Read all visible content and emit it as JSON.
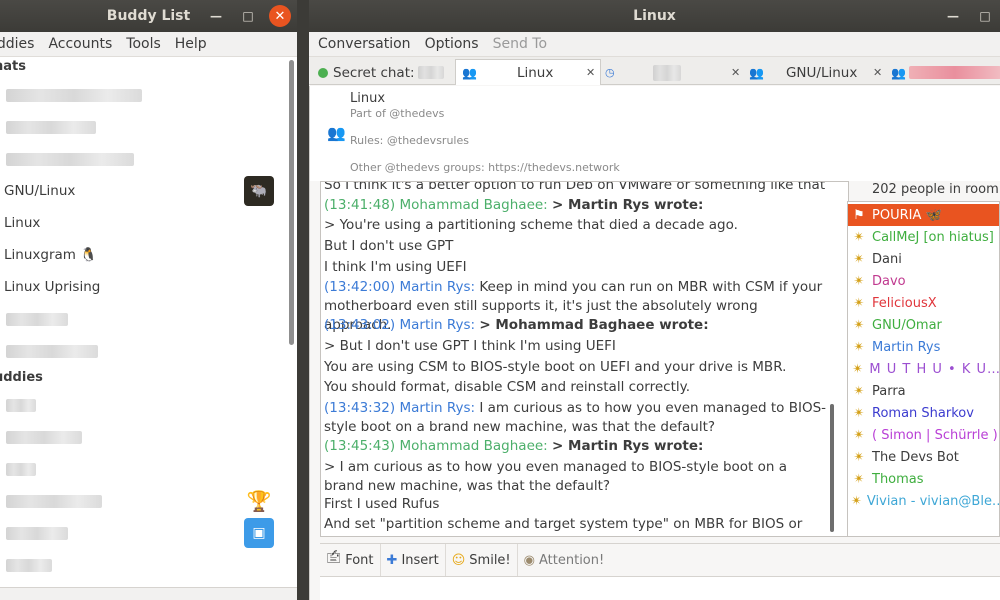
{
  "buddy_window": {
    "title": "Buddy List",
    "menu": [
      "uddies",
      "Accounts",
      "Tools",
      "Help"
    ],
    "groups": [
      {
        "label": "hats"
      },
      {
        "label": "uddies"
      }
    ],
    "chats": [
      {
        "label": "GNU/Linux",
        "icon": "gnu-linux-avatar-icon"
      },
      {
        "label": "Linux"
      },
      {
        "label": "Linuxgram 🐧"
      },
      {
        "label": "Linux Uprising"
      }
    ],
    "status_icons": [
      "trophy-icon",
      "chat-bubble-icon"
    ]
  },
  "chat_window": {
    "title": "Linux",
    "menu": {
      "conversation": "Conversation",
      "options": "Options",
      "send_to": "Send To"
    },
    "tabs": [
      {
        "label": "Secret chat:"
      },
      {
        "label": "Linux"
      },
      {
        "label": "GNU/Linux"
      }
    ],
    "topic": {
      "name": "Linux",
      "part_of": "Part of @thedevs",
      "rules": "Rules: @thedevsrules",
      "other": "Other @thedevs groups: https://thedevs.network"
    },
    "messages": [
      {
        "text": "So I think it's a better option to run Deb on VMware or something like that"
      },
      {
        "time": "(13:41:48)",
        "sender": "Mohammad Baghaee:",
        "quote": "> Martin Rys wrote:",
        "color": "green"
      },
      {
        "text": "> You're using a partitioning scheme that died a decade ago."
      },
      {
        "text": "But I don't use GPT"
      },
      {
        "text": "I think I'm using UEFI"
      },
      {
        "time": "(13:42:00)",
        "sender": "Martin Rys:",
        "body": "Keep in mind you can run on MBR with CSM if your motherboard even still supports it, it's just the absolutely wrong approach.",
        "color": "blue"
      },
      {
        "time": "(13:43:02)",
        "sender": "Martin Rys:",
        "quote": "> Mohammad Baghaee wrote:",
        "color": "blue"
      },
      {
        "text": "> But I don't use GPT  I think I'm using UEFI"
      },
      {
        "text": "You are using CSM to BIOS-style boot on UEFI and your drive is MBR."
      },
      {
        "text": "You should format, disable CSM and reinstall correctly."
      },
      {
        "time": "(13:43:32)",
        "sender": "Martin Rys:",
        "body": "I am curious as to how you even managed to BIOS-style boot on a brand new machine, was that the default?",
        "color": "blue"
      },
      {
        "time": "(13:45:43)",
        "sender": "Mohammad Baghaee:",
        "quote": "> Martin Rys wrote:",
        "color": "green"
      },
      {
        "text": "> I am curious as to how you even managed to BIOS-style boot on a brand new machine, was that the default?"
      },
      {
        "text": "First I used Rufus"
      },
      {
        "text": "And set \"partition scheme and target system type\" on MBR for BIOS or UEFI😅"
      }
    ],
    "people_count": "202 people in room",
    "people": [
      {
        "name": "POURIA 🦋",
        "color": "#ffffff",
        "selected": true
      },
      {
        "name": "CallMeJ [on hiatus]",
        "color": "#3fae3f"
      },
      {
        "name": "Dani",
        "color": "#3c3c3c"
      },
      {
        "name": "Davo",
        "color": "#c0398f"
      },
      {
        "name": "FeliciousX",
        "color": "#e0353b"
      },
      {
        "name": "GNU/Omar",
        "color": "#3fae3f"
      },
      {
        "name": "Martin Rys",
        "color": "#3c7bd6"
      },
      {
        "name": "M U T H U • K U…",
        "color": "#9c4fd1"
      },
      {
        "name": "Parra",
        "color": "#3c3c3c"
      },
      {
        "name": "Roman Sharkov",
        "color": "#3c3ccf"
      },
      {
        "name": "( Simon | Schürrle )",
        "color": "#b93fd6"
      },
      {
        "name": "The Devs Bot",
        "color": "#3c3c3c"
      },
      {
        "name": "Thomas",
        "color": "#3fae3f"
      },
      {
        "name": "Vivian - vivian@Ble…",
        "color": "#3ea7d6"
      }
    ],
    "toolbar": {
      "font": "Font",
      "insert": "Insert",
      "smile": "Smile!",
      "attention": "Attention!"
    }
  }
}
